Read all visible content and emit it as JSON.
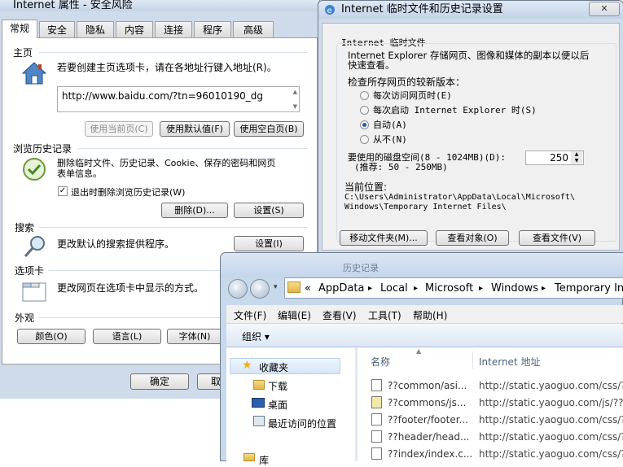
{
  "ie_options": {
    "title": "Internet 属性 - 安全风险",
    "tabs": [
      "常规",
      "安全",
      "隐私",
      "内容",
      "连接",
      "程序",
      "高级"
    ],
    "homepage": {
      "section": "主页",
      "description": "若要创建主页选项卡，请在各地址行键入地址(R)。",
      "url": "http://www.baidu.com/?tn=96010190_dg",
      "btn_current": "使用当前页(C)",
      "btn_default": "使用默认值(F)",
      "btn_blank": "使用空白页(B)"
    },
    "history": {
      "section": "浏览历史记录",
      "description_line1": "删除临时文件、历史记录、Cookie、保存的密码和网页",
      "description_line2": "表单信息。",
      "checkbox_label": "退出时删除浏览历史记录(W)",
      "btn_delete": "删除(D)...",
      "btn_settings": "设置(S)"
    },
    "search": {
      "section": "搜索",
      "description": "更改默认的搜索提供程序。",
      "btn_settings": "设置(I)"
    },
    "tabsec": {
      "section": "选项卡",
      "description": "更改网页在选项卡中显示的方式。"
    },
    "appearance": {
      "section": "外观",
      "btn_colors": "颜色(O)",
      "btn_languages": "语言(L)",
      "btn_fonts": "字体(N)"
    },
    "btn_ok": "确定",
    "btn_cancel_partial": "取"
  },
  "temp_dialog": {
    "title": "Internet 临时文件和历史记录设置",
    "group_label": "Internet 临时文件",
    "intro_line1": "Internet Explorer 存储网页、图像和媒体的副本以便以后",
    "intro_line2": "快速查看。",
    "check_label": "检查所存网页的较新版本：",
    "radios": [
      {
        "label": "每次访问网页时(E)",
        "checked": false
      },
      {
        "label": "每次启动 Internet Explorer 时(S)",
        "checked": false
      },
      {
        "label": "自动(A)",
        "checked": true
      },
      {
        "label": "从不(N)",
        "checked": false
      }
    ],
    "disk_label": "要使用的磁盘空间(8 - 1024MB)(D):",
    "disk_hint": "(推荐: 50 - 250MB)",
    "disk_value": "250",
    "location_label": "当前位置:",
    "location_line1": "C:\\Users\\Administrator\\AppData\\Local\\Microsoft\\",
    "location_line2": "Windows\\Temporary Internet Files\\",
    "btn_move": "移动文件夹(M)...",
    "btn_view_objects": "查看对象(O)",
    "btn_view_files": "查看文件(V)"
  },
  "explorer": {
    "breadcrumb": [
      "AppData",
      "Local",
      "Microsoft",
      "Windows",
      "Temporary Int"
    ],
    "breadcrumb_prefix": "«",
    "menu": [
      "文件(F)",
      "编辑(E)",
      "查看(V)",
      "工具(T)",
      "帮助(H)"
    ],
    "organize": "组织 ▾",
    "nav": [
      "收藏夹",
      "下载",
      "桌面",
      "最近访问的位置",
      "库"
    ],
    "col_name": "名称",
    "col_address": "Internet 地址",
    "background_label": "历史记录",
    "files": [
      {
        "name": "??common/asi...",
        "address": "http://static.yaoguo.com/css/?"
      },
      {
        "name": "??commons/js...",
        "address": "http://static.yaoguo.com/js/??c"
      },
      {
        "name": "??footer/footer...",
        "address": "http://static.yaoguo.com/css/?"
      },
      {
        "name": "??header/head...",
        "address": "http://static.yaoguo.com/css/?"
      },
      {
        "name": "??index/index.c...",
        "address": "http://static.yaoguo.com/css/?"
      }
    ]
  }
}
